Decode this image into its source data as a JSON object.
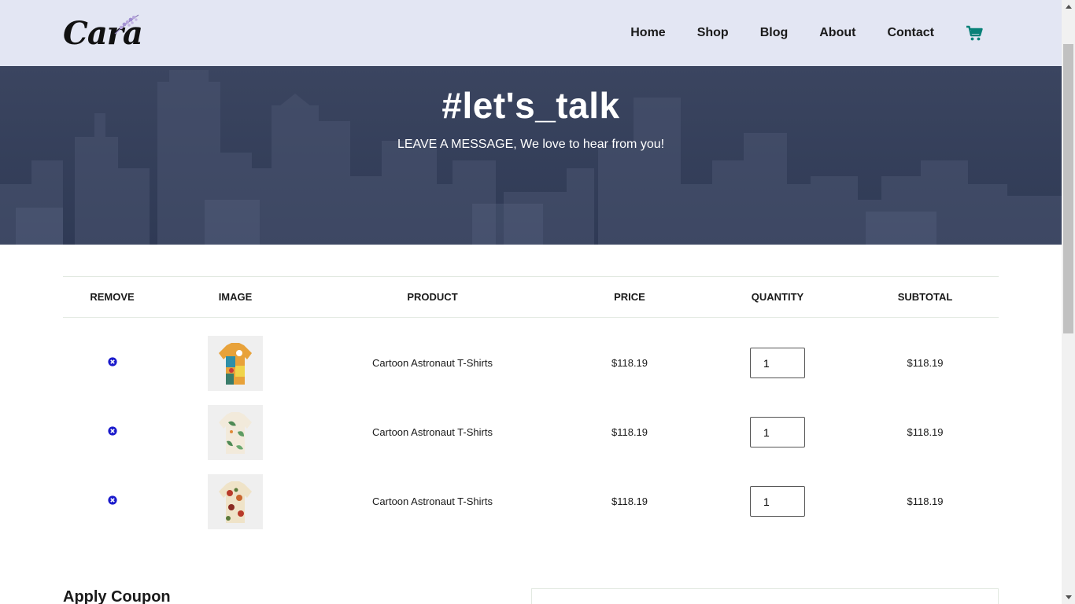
{
  "header": {
    "logo": "Cara",
    "nav": [
      "Home",
      "Shop",
      "Blog",
      "About",
      "Contact"
    ],
    "cart_icon": "shopping-cart-icon",
    "accent_color": "#088178"
  },
  "hero": {
    "title": "#let's_talk",
    "subtitle": "LEAVE A MESSAGE, We love to hear from you!"
  },
  "cart": {
    "columns": [
      "Remove",
      "Image",
      "Product",
      "Price",
      "Quantity",
      "Subtotal"
    ],
    "rows": [
      {
        "product": "Cartoon Astronaut T-Shirts",
        "price": "$118.19",
        "quantity": "1",
        "subtotal": "$118.19",
        "image_icon": "shirt-image"
      },
      {
        "product": "Cartoon Astronaut T-Shirts",
        "price": "$118.19",
        "quantity": "1",
        "subtotal": "$118.19",
        "image_icon": "shirt-image"
      },
      {
        "product": "Cartoon Astronaut T-Shirts",
        "price": "$118.19",
        "quantity": "1",
        "subtotal": "$118.19",
        "image_icon": "shirt-image"
      }
    ],
    "remove_icon": "remove-circle-icon",
    "remove_color": "#1a1acc"
  },
  "coupon": {
    "title": "Apply Coupon"
  }
}
